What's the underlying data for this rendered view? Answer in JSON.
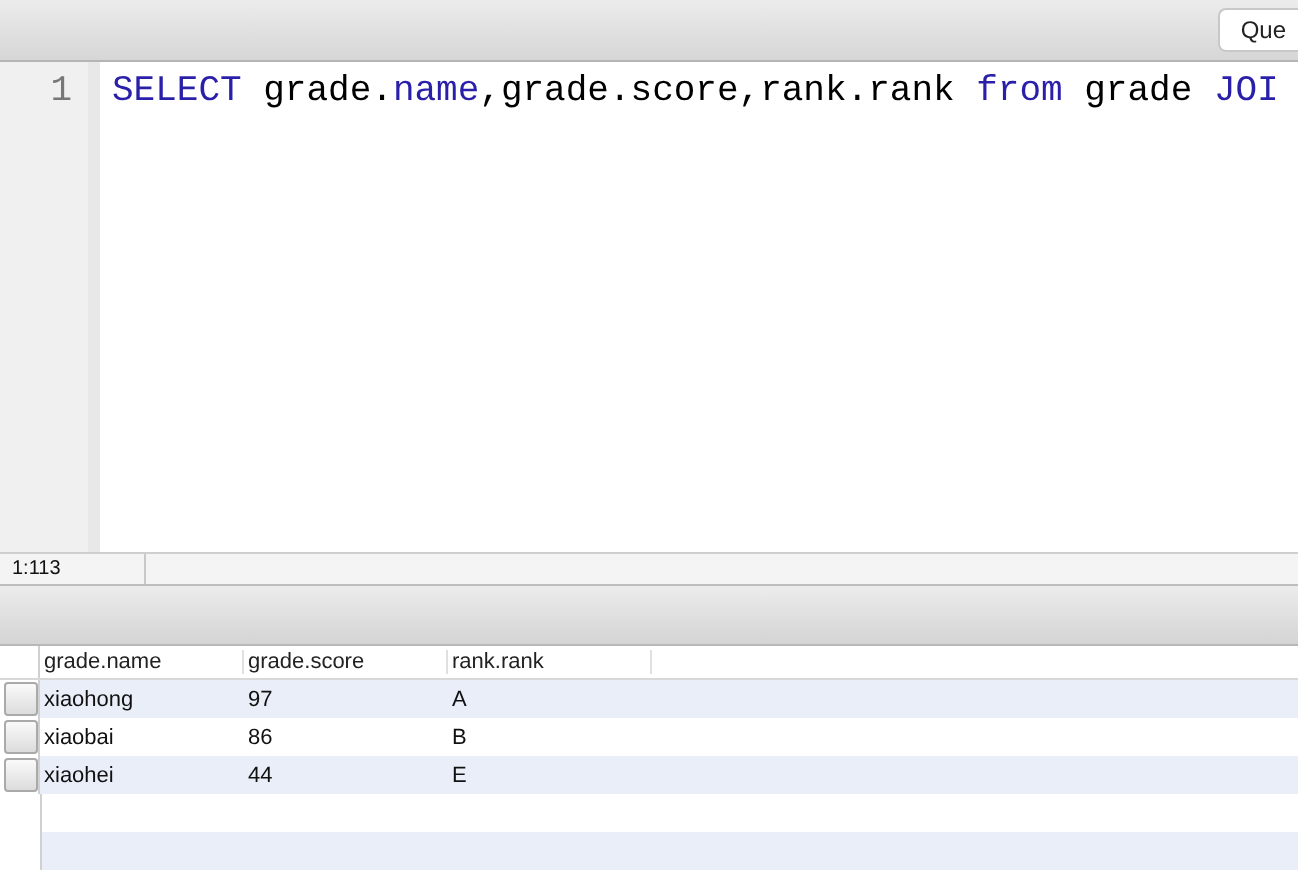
{
  "toolbar": {
    "button": "Que"
  },
  "editor": {
    "lines": [
      {
        "number": "1",
        "tokens": [
          {
            "text": "SELECT",
            "kind": "keyword"
          },
          {
            "text": " grade.",
            "kind": "plain"
          },
          {
            "text": "name",
            "kind": "keyword"
          },
          {
            "text": ",grade.score,rank.rank ",
            "kind": "plain"
          },
          {
            "text": "from",
            "kind": "keyword"
          },
          {
            "text": " grade ",
            "kind": "plain"
          },
          {
            "text": "JOI",
            "kind": "keyword"
          }
        ]
      }
    ]
  },
  "status_bar": {
    "position": "1:113"
  },
  "table": {
    "columns": [
      "grade.name",
      "grade.score",
      "rank.rank"
    ],
    "rows": [
      [
        "xiaohong",
        "97",
        "A"
      ],
      [
        "xiaobai",
        "86",
        "B"
      ],
      [
        "xiaohei",
        "44",
        "E"
      ]
    ]
  }
}
